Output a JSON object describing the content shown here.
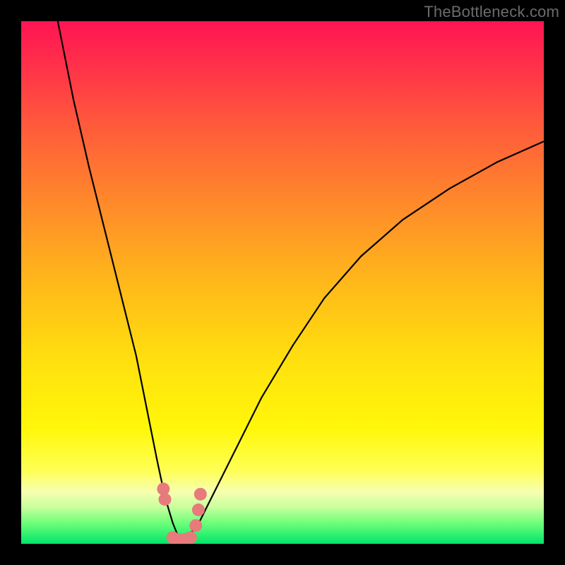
{
  "watermark": "TheBottleneck.com",
  "chart_data": {
    "type": "line",
    "title": "",
    "xlabel": "",
    "ylabel": "",
    "xlim": [
      0,
      100
    ],
    "ylim": [
      0,
      100
    ],
    "series": [
      {
        "name": "curve",
        "x": [
          7,
          10,
          13,
          16,
          19,
          22,
          24,
          26,
          27.5,
          29,
          30,
          31,
          32,
          34,
          37,
          41,
          46,
          52,
          58,
          65,
          73,
          82,
          91,
          100
        ],
        "y": [
          100,
          85,
          72,
          60,
          48,
          36,
          26,
          16,
          9,
          4,
          1.5,
          0.8,
          1.5,
          4,
          10,
          18,
          28,
          38,
          47,
          55,
          62,
          68,
          73,
          77
        ]
      }
    ],
    "markers": {
      "name": "highlight-dots",
      "color": "#e77b7b",
      "x": [
        27.2,
        27.5,
        29.0,
        30.2,
        31.3,
        32.4,
        33.4,
        33.9,
        34.3
      ],
      "y": [
        10.5,
        8.5,
        1.2,
        0.8,
        0.8,
        1.2,
        3.5,
        6.5,
        9.5
      ]
    },
    "background_gradient": {
      "top": "#ff1452",
      "mid": "#ffe00e",
      "bottom": "#00e56a"
    }
  }
}
